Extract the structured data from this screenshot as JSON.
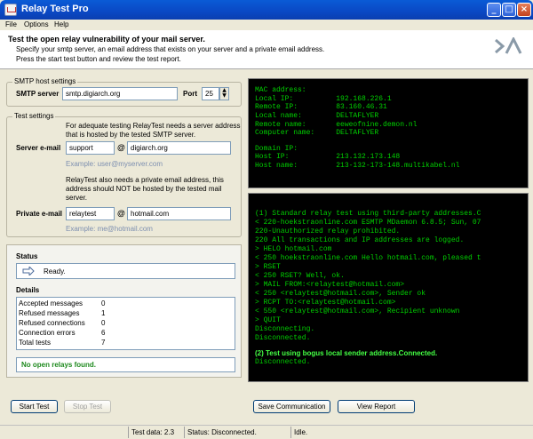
{
  "window": {
    "title": "Relay Test Pro"
  },
  "menu": [
    "File",
    "Options",
    "Help"
  ],
  "header": {
    "title": "Test the open relay vulnerability of your mail server.",
    "lines": [
      "Specify your smtp server, an email address that exists on your server and a private email address.",
      "Press the start test button and review the test report."
    ]
  },
  "smtp": {
    "group": "SMTP host settings",
    "label": "SMTP server",
    "value": "smtp.digiarch.org",
    "port_label": "Port",
    "port": "25"
  },
  "test_settings": {
    "group": "Test settings",
    "server_note": [
      "For adequate testing RelayTest needs a server address",
      "that is hosted by the tested SMTP server."
    ],
    "server_label": "Server e-mail",
    "server_user": "support",
    "server_domain": "digiarch.org",
    "server_example": "Example: user@myserver.com",
    "private_note": [
      "RelayTest also needs a private email address, this",
      "address should NOT be hosted by the tested mail",
      "server."
    ],
    "private_label": "Private e-mail",
    "private_user": "relaytest",
    "private_domain": "hotmail.com",
    "private_example": "Example: me@hotmail.com",
    "at": "@"
  },
  "status": {
    "heading": "Status",
    "text": "Ready.",
    "details_heading": "Details",
    "details": [
      {
        "label": "Accepted messages",
        "value": "0"
      },
      {
        "label": "Refused messages",
        "value": "1"
      },
      {
        "label": "Refused connections",
        "value": "0"
      },
      {
        "label": "Connection errors",
        "value": "6"
      },
      {
        "label": "Total tests",
        "value": "7"
      }
    ],
    "result": "No open relays found."
  },
  "info_console": [
    "MAC address:",
    "Local IP:          192.168.226.1",
    "Remote IP:         83.160.46.31",
    "Local name:        DELTAFLYER",
    "Remote name:       eeweofnine.demon.nl",
    "Computer name:     DELTAFLYER",
    "",
    "Domain IP:",
    "Host IP:           213.132.173.148",
    "Host name:         213-132-173-148.multikabel.nl"
  ],
  "log_console": [
    "(1) Standard relay test using third-party addresses.C",
    "< 220-hoekstraonline.com ESMTP MDaemon 6.8.5; Sun, 07",
    "220-Unauthorized relay prohibited.",
    "220 All transactions and IP addresses are logged.",
    "> HELO hotmail.com",
    "< 250 hoekstraonline.com Hello hotmail.com, pleased t",
    "> RSET",
    "< 250 RSET? Well, ok.",
    "> MAIL FROM:<relaytest@hotmail.com>",
    "< 250 <relaytest@hotmail.com>, Sender ok",
    "> RCPT TO:<relaytest@hotmail.com>",
    "< 550 <relaytest@hotmail.com>, Recipient unknown",
    "> QUIT",
    "Disconnecting.",
    "Disconnected.",
    "",
    "(2) Test using bogus local sender address.Connected.",
    "Disconnected."
  ],
  "buttons": {
    "start": "Start Test",
    "stop": "Stop Test",
    "save": "Save Communication",
    "report": "View Report"
  },
  "statusbar": {
    "test_data": "Test data: 2.3",
    "status": "Status: Disconnected.",
    "state": "Idle."
  }
}
